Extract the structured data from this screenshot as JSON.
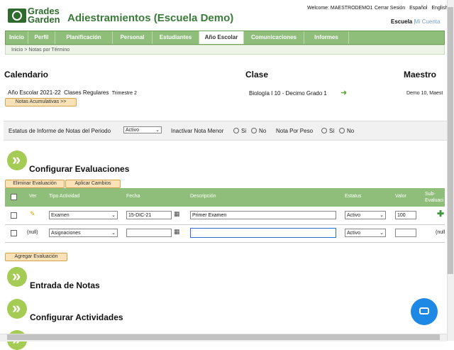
{
  "header": {
    "logo_line1": "Grades",
    "logo_line2": "Garden",
    "app_title": "Adiestramientos (Escuela Demo)",
    "welcome": "Welcome: MAESTRODEMO1",
    "links": [
      "Cerrar Sesión",
      "Español",
      "English"
    ],
    "escuela": "Escuela",
    "separator": "|",
    "mi_cuenta": "Mi Cuenta"
  },
  "nav": {
    "items": [
      "Inicio",
      "Perfil",
      "Planificación",
      "Personal",
      "Estudiantes",
      "Año Escolar",
      "Comunicaciones",
      "Informes"
    ],
    "active": "Año Escolar"
  },
  "breadcrumb": [
    "Inicio",
    "Notas por Término"
  ],
  "breadcrumb_sep": ">",
  "calendario": {
    "title": "Calendario",
    "year": "Año Escolar 2021-22",
    "type": "Clases Regulares",
    "term": "Trimestre 2",
    "button": "Notas Acumulativas >>"
  },
  "clase": {
    "title": "Clase",
    "name": "Biología I 10 -  Decimo Grado  1"
  },
  "maestro": {
    "title": "Maestro",
    "name": "Demo 10, Maest"
  },
  "filters": {
    "estatus_label": "Estatus de Informe de Notas del Periodo",
    "estatus_value": "Activo",
    "inactivar_label": "Inactivar Nota Menor",
    "por_peso_label": "Nota Por Peso",
    "si": "Si",
    "no": "No"
  },
  "configurar": {
    "title": "Configurar Evaluaciones",
    "eliminar": "Eliminar Evaluación",
    "aplicar": "Aplicar Cambios",
    "agregar": "Agregar Evaluación"
  },
  "table": {
    "headers": {
      "ver": "Ver",
      "tipo": "Tipo Actividad",
      "fecha": "Fecha",
      "descripcion": "Descripción",
      "estatus": "Estatus",
      "valor": "Valor",
      "sub": "Sub-\nEvaluaci"
    },
    "rows": [
      {
        "ver": "",
        "tipo": "Examen",
        "fecha": "15-DIC-21",
        "descripcion": "Primer Examen",
        "estatus": "Activo",
        "valor": "100",
        "sub": ""
      },
      {
        "ver": "(null)",
        "tipo": "Asignaciones",
        "fecha": "",
        "descripcion": "",
        "estatus": "Activo",
        "valor": "",
        "sub": "(null"
      }
    ]
  },
  "sections": {
    "entrada": "Entrada de Notas",
    "actividades": "Configurar Actividades"
  },
  "colors": {
    "nav_green": "#8fbe7a",
    "title_green": "#3a7b3a",
    "button_orange": "#f9e2b8",
    "chat_blue": "#1e88e5"
  }
}
